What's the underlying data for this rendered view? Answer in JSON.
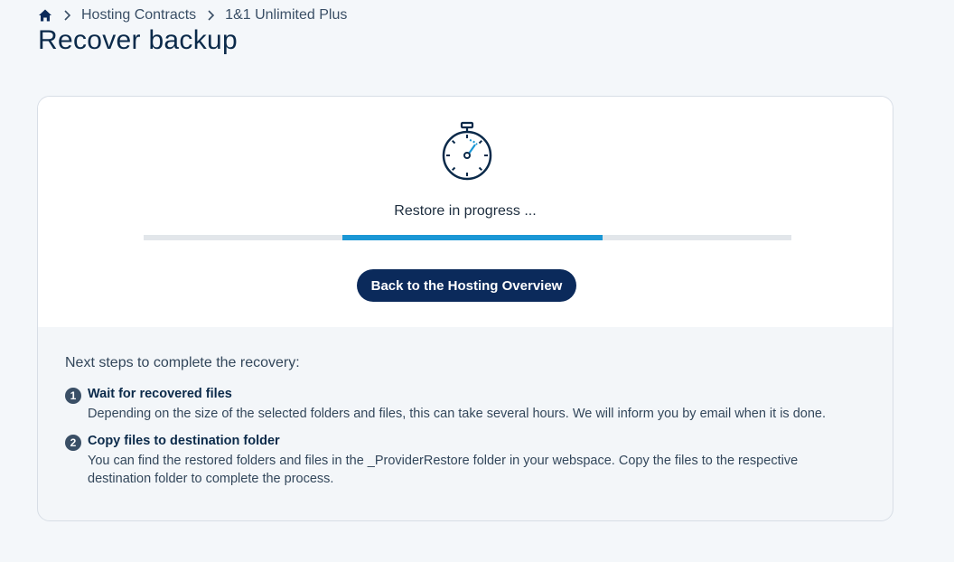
{
  "breadcrumb": {
    "home_icon": "home-icon",
    "items": [
      "Hosting Contracts",
      "1&1 Unlimited Plus"
    ]
  },
  "page": {
    "title": "Recover backup"
  },
  "restore": {
    "icon": "stopwatch-icon",
    "status": "Restore in progress ...",
    "progress_segment": {
      "start_fraction": 0.307,
      "end_fraction": 0.709
    },
    "back_button": "Back to the Hosting Overview"
  },
  "next_steps": {
    "title": "Next steps to complete the recovery:",
    "steps": [
      {
        "number": "1",
        "title": "Wait for recovered files",
        "description": "Depending on the size of the selected folders and files, this can take several hours. We will inform you by email when it is done."
      },
      {
        "number": "2",
        "title": "Copy files to destination folder",
        "description": "You can find the restored folders and files in the _ProviderRestore folder in your webspace. Copy the files to the respective destination folder to complete the process."
      }
    ]
  },
  "colors": {
    "primary": "#0b2a5b",
    "progress": "#1b97d5",
    "track": "#e2e6ea"
  }
}
